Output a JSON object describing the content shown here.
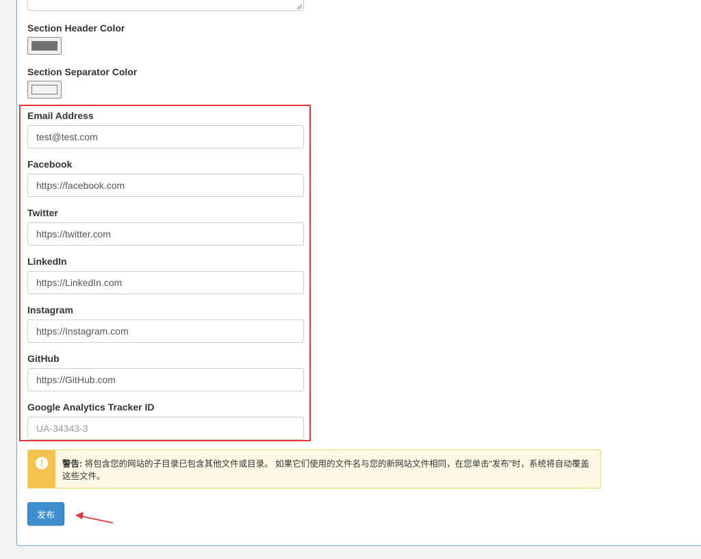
{
  "form": {
    "section_header_color_label": "Section Header Color",
    "section_separator_color_label": "Section Separator Color",
    "colors": {
      "section_header": "#707070",
      "section_separator": "#f2f2f2",
      "highlight": "#e5343a",
      "accent": "#3d8ed0",
      "warning": "#f4c24f"
    },
    "fields": {
      "email": {
        "label": "Email Address",
        "value": "test@test.com",
        "placeholder": ""
      },
      "facebook": {
        "label": "Facebook",
        "value": "https://facebook.com",
        "placeholder": ""
      },
      "twitter": {
        "label": "Twitter",
        "value": "https://twitter.com",
        "placeholder": ""
      },
      "linkedin": {
        "label": "LinkedIn",
        "value": "https://LinkedIn.com",
        "placeholder": ""
      },
      "instagram": {
        "label": "Instagram",
        "value": "https://Instagram.com",
        "placeholder": ""
      },
      "github": {
        "label": "GitHub",
        "value": "https://GitHub.com",
        "placeholder": ""
      },
      "google_analytics": {
        "label": "Google Analytics Tracker ID",
        "value": "",
        "placeholder": "UA-34343-3"
      }
    }
  },
  "alert": {
    "icon": "exclamation-icon",
    "glyph": "!",
    "prefix": "警告:",
    "message": "将包含您的网站的子目录已包含其他文件或目录。 如果它们使用的文件名与您的新网站文件相同，在您单击“发布”时，系统将自动覆盖这些文件。"
  },
  "actions": {
    "publish_label": "发布"
  }
}
